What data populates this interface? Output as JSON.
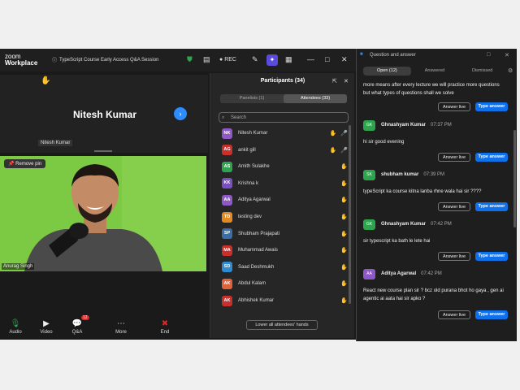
{
  "zoom": {
    "logo_line1": "zoom",
    "logo_line2": "Workplace",
    "meeting_title": "TypeScript Course Early Access Q&A Session",
    "rec_label": "REC"
  },
  "main_tile": {
    "name": "Nitesh Kumar",
    "label": "Nitesh Kumar"
  },
  "video_tile": {
    "pin_label": "Remove pin",
    "name": "Anurag Singh"
  },
  "toolbar": [
    {
      "label": "Audio",
      "icon": "🎙"
    },
    {
      "label": "Video",
      "icon": "📹"
    },
    {
      "label": "Q&A",
      "icon": "💬",
      "badge": "12"
    },
    {
      "label": "More",
      "icon": "⋯"
    },
    {
      "label": "End",
      "icon": "✖"
    }
  ],
  "participants": {
    "title": "Participants (34)",
    "tab_panelists": "Panelists (1)",
    "tab_attendees": "Attendees (33)",
    "search_placeholder": "Search",
    "lower_hands": "Lower all attendees' hands",
    "list": [
      {
        "initials": "NK",
        "name": "Nitesh Kumar",
        "color": "#8e59c7",
        "hand": true,
        "mic": "on"
      },
      {
        "initials": "AG",
        "name": "ankit gill",
        "color": "#c9302c",
        "hand": true,
        "mic": "muted"
      },
      {
        "initials": "AS",
        "name": "Amith Sulakhe",
        "color": "#2ea44f",
        "hand": true,
        "mic": ""
      },
      {
        "initials": "KK",
        "name": "Krishna k",
        "color": "#7b4fc4",
        "hand": true,
        "mic": ""
      },
      {
        "initials": "AA",
        "name": "Aditya Agarwal",
        "color": "#8e59c7",
        "hand": true,
        "mic": ""
      },
      {
        "initials": "TD",
        "name": "testing dev",
        "color": "#e58a1f",
        "hand": true,
        "mic": ""
      },
      {
        "initials": "SP",
        "name": "Shubham Prajapati",
        "color": "#3a6ea5",
        "hand": true,
        "mic": ""
      },
      {
        "initials": "MA",
        "name": "Muhammad Awais",
        "color": "#c9302c",
        "hand": true,
        "mic": ""
      },
      {
        "initials": "SD",
        "name": "Saad Deshmukh",
        "color": "#2e8bd1",
        "hand": true,
        "mic": ""
      },
      {
        "initials": "AK",
        "name": "Abdul Kalam",
        "color": "#e0623a",
        "hand": true,
        "mic": ""
      },
      {
        "initials": "AK",
        "name": "Abhishek Kumar",
        "color": "#c9302c",
        "hand": true,
        "mic": ""
      }
    ]
  },
  "qa": {
    "title": "Question and answer",
    "tab_open": "Open (12)",
    "tab_answered": "Answered",
    "tab_dismissed": "Dismissed",
    "answer_live": "Answer live",
    "type_answer": "Type answer",
    "top_text": "more means after every lecture we will practice more questions but what types of questions shall we solve",
    "items": [
      {
        "initials": "GK",
        "name": "Ghnashyam Kumar",
        "time": "07:37 PM",
        "text": "hi sir good evening",
        "color": "#2ea44f"
      },
      {
        "initials": "SK",
        "name": "shubham kumar",
        "time": "07:39 PM",
        "text": "typeScript ka course kitna lanba rhne wala hai sir ????",
        "color": "#2ea44f"
      },
      {
        "initials": "GK",
        "name": "Ghnashyam Kumar",
        "time": "07:42 PM",
        "text": "sir typescript ka bath le lete hai",
        "color": "#2ea44f"
      },
      {
        "initials": "AA",
        "name": "Aditya Agarwal",
        "time": "07:42 PM",
        "text": "React new course plan sir ? bcz old purana bhot ho gaya , gen ai agentic ai  aata hai sir apko ?",
        "color": "#8e59c7"
      }
    ]
  }
}
